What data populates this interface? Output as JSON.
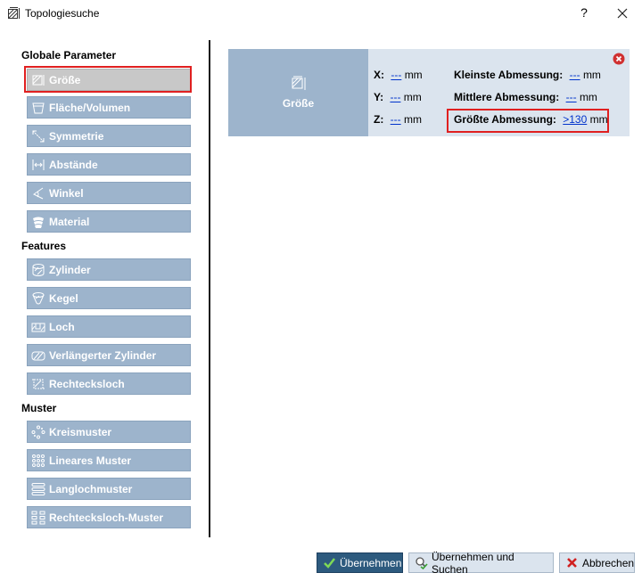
{
  "window": {
    "title": "Topologiesuche",
    "help": "?"
  },
  "sidebar": {
    "sections": [
      "Globale Parameter",
      "Features",
      "Muster"
    ],
    "global": [
      {
        "label": "Größe",
        "icon": "size-icon"
      },
      {
        "label": "Fläche/Volumen",
        "icon": "area-volume-icon"
      },
      {
        "label": "Symmetrie",
        "icon": "symmetry-icon"
      },
      {
        "label": "Abstände",
        "icon": "distance-icon"
      },
      {
        "label": "Winkel",
        "icon": "angle-icon"
      },
      {
        "label": "Material",
        "icon": "material-icon"
      }
    ],
    "features": [
      {
        "label": "Zylinder",
        "icon": "cylinder-icon"
      },
      {
        "label": "Kegel",
        "icon": "cone-icon"
      },
      {
        "label": "Loch",
        "icon": "hole-icon"
      },
      {
        "label": "Verlängerter Zylinder",
        "icon": "extended-cylinder-icon"
      },
      {
        "label": "Rechtecksloch",
        "icon": "rectangular-hole-icon"
      }
    ],
    "patterns": [
      {
        "label": "Kreismuster",
        "icon": "circular-pattern-icon"
      },
      {
        "label": "Lineares Muster",
        "icon": "linear-pattern-icon"
      },
      {
        "label": "Langlochmuster",
        "icon": "slot-pattern-icon"
      },
      {
        "label": "Rechtecksloch-Muster",
        "icon": "rectangular-hole-pattern-icon"
      }
    ],
    "active": "Größe"
  },
  "panel": {
    "title": "Größe",
    "x_label": "X:",
    "x_value": "---",
    "x_unit": "mm",
    "y_label": "Y:",
    "y_value": "---",
    "y_unit": "mm",
    "z_label": "Z:",
    "z_value": "---",
    "z_unit": "mm",
    "min_label": "Kleinste Abmessung:",
    "min_value": "---",
    "min_unit": "mm",
    "mid_label": "Mittlere Abmessung:",
    "mid_value": "---",
    "mid_unit": "mm",
    "max_label": "Größte Abmessung:",
    "max_value": ">130",
    "max_unit": "mm"
  },
  "buttons": {
    "apply": "Übernehmen",
    "apply_search": "Übernehmen und Suchen",
    "cancel": "Abbrechen"
  },
  "colors": {
    "nav_button": "#9db4cc",
    "active_button": "#c8c8c8",
    "highlight": "#e02020",
    "primary_button": "#2d5a7e",
    "panel_bg": "#dbe4ee"
  }
}
